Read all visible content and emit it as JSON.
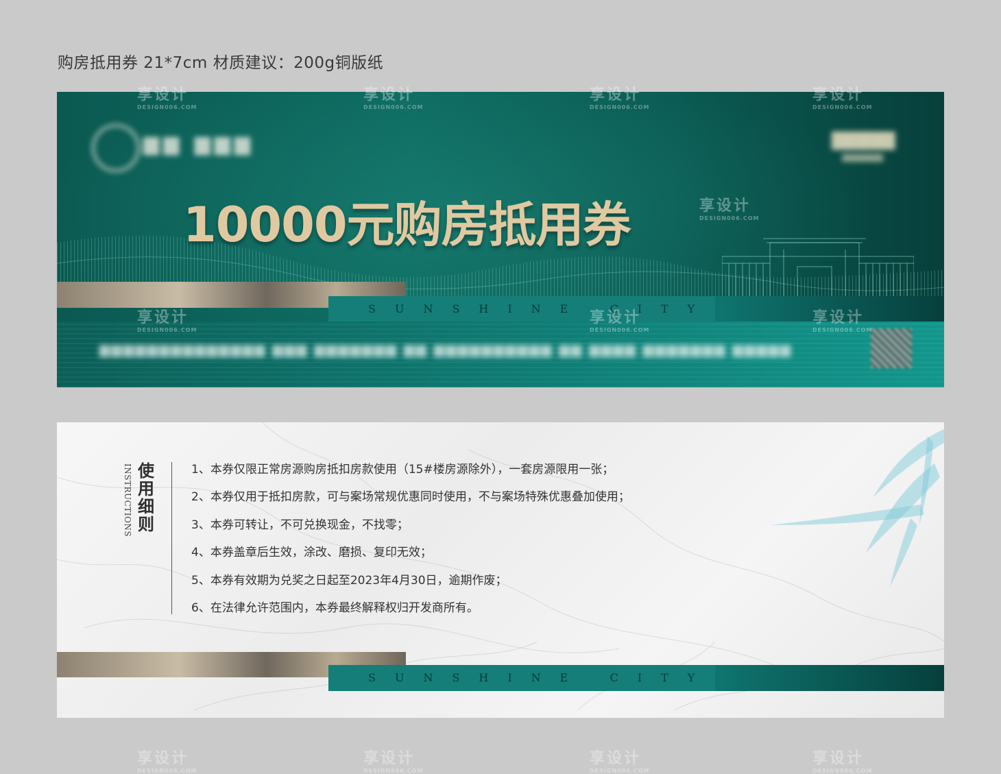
{
  "spec_line": "购房抵用券  21*7cm  材质建议：200g铜版纸",
  "front": {
    "title": "10000元购房抵用券",
    "sunshine_city": "SUNSHINE CITY"
  },
  "back": {
    "title_cn": [
      "使",
      "用",
      "细",
      "则"
    ],
    "title_en": "INSTRUCTIONS",
    "rules": [
      "1、本券仅限正常房源购房抵扣房款使用（15#楼房源除外），一套房源限用一张；",
      "2、本券仅用于抵扣房款，可与案场常规优惠同时使用，不与案场特殊优惠叠加使用；",
      "3、本券可转让，不可兑换现金，不找零；",
      "4、本券盖章后生效，涂改、磨损、复印无效；",
      "5、本券有效期为兑奖之日起至2023年4月30日，逾期作废；",
      "6、在法律允许范围内，本券最终解释权归开发商所有。"
    ],
    "sunshine_city": "SUNSHINE CITY"
  },
  "watermark": {
    "text": "享设计",
    "sub": "DESIGN006.COM"
  },
  "colors": {
    "teal": "#0d6a60",
    "gold": "#e0c9a1",
    "background": "#c9cac9"
  }
}
